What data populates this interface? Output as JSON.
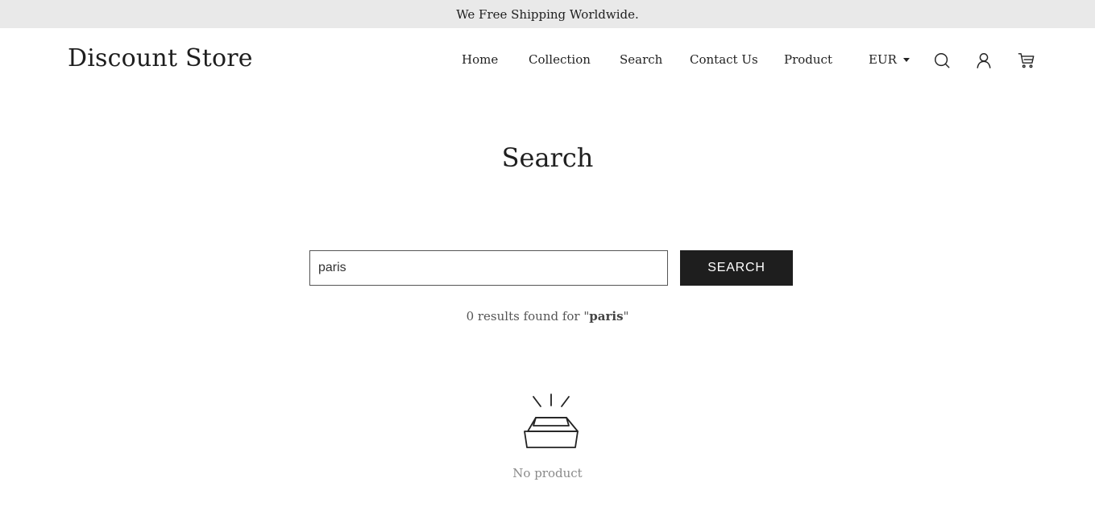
{
  "announcement": "We Free Shipping Worldwide.",
  "header": {
    "logo": "Discount Store",
    "nav": [
      "Home",
      "Collection",
      "Search",
      "Contact Us",
      "Product"
    ],
    "currency": "EUR",
    "icons": [
      "search-icon",
      "account-icon",
      "cart-icon"
    ]
  },
  "search": {
    "title": "Search",
    "query": "paris",
    "button_label": "SEARCH",
    "results_prefix": "0 results found for \"",
    "results_term": "paris",
    "results_suffix": "\""
  },
  "empty_state": {
    "icon": "empty-box-icon",
    "label": "No product"
  },
  "colors": {
    "announcement_bg": "#e9e9e9",
    "button_bg": "#1e1e1e",
    "button_text": "#ffffff",
    "muted_text": "#8a8a8a"
  }
}
